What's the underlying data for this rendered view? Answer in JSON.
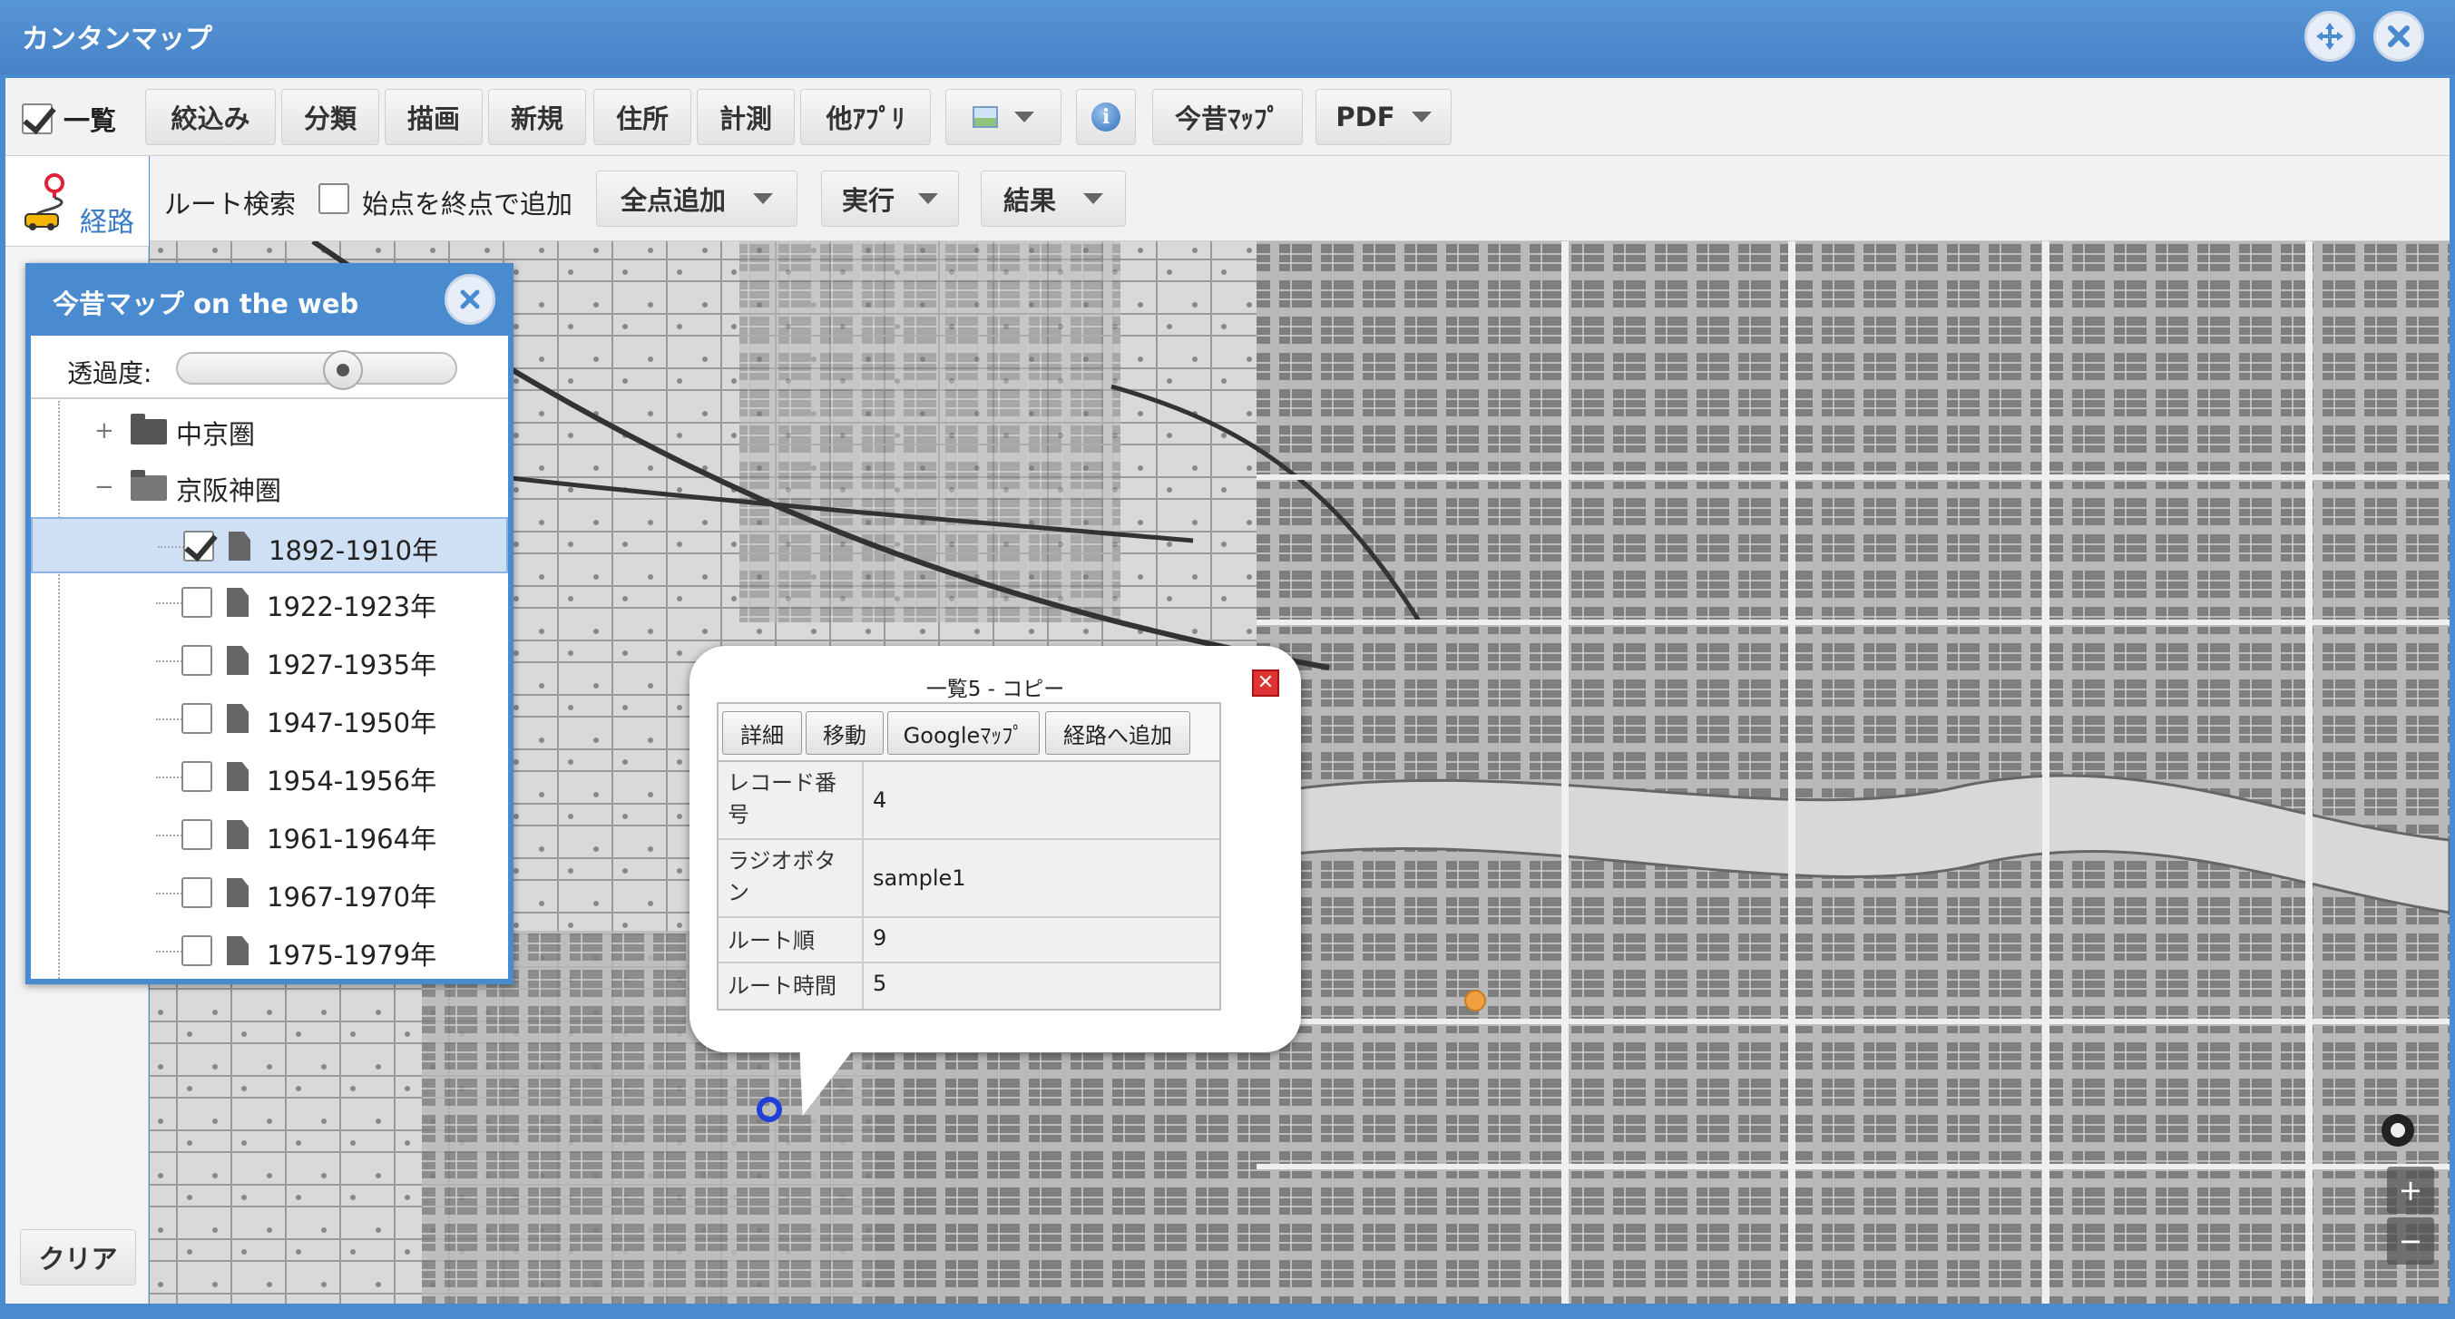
{
  "window": {
    "title": "カンタンマップ"
  },
  "toolbar": {
    "list_label": "一覧",
    "list_checked": true,
    "buttons": [
      "絞込み",
      "分類",
      "描画",
      "新規",
      "住所",
      "計測",
      "他ｱﾌﾟﾘ"
    ],
    "image_button_icon": "map-image-icon",
    "info_button_icon": "info-icon",
    "konjaku_button": "今昔ﾏｯﾌﾟ",
    "pdf_button": "PDF"
  },
  "side": {
    "route_tab_label": "経路",
    "clear_button": "クリア"
  },
  "route_bar": {
    "label": "ルート検索",
    "checkbox_label": "始点を終点で追加",
    "add_all_button": "全点追加",
    "run_button": "実行",
    "result_button": "結果"
  },
  "layer_panel": {
    "title": "今昔マップ on the web",
    "opacity_label": "透過度:",
    "opacity_value": 0.6,
    "folders": [
      {
        "label": "中京圏",
        "expanded": false
      },
      {
        "label": "京阪神圏",
        "expanded": true
      }
    ],
    "layers": [
      {
        "label": "1892-1910年",
        "checked": true,
        "selected": true
      },
      {
        "label": "1922-1923年",
        "checked": false
      },
      {
        "label": "1927-1935年",
        "checked": false
      },
      {
        "label": "1947-1950年",
        "checked": false
      },
      {
        "label": "1954-1956年",
        "checked": false
      },
      {
        "label": "1961-1964年",
        "checked": false
      },
      {
        "label": "1967-1970年",
        "checked": false
      },
      {
        "label": "1975-1979年",
        "checked": false
      }
    ]
  },
  "popup": {
    "title": "一覧5 - コピー",
    "buttons": [
      "詳細",
      "移動",
      "Googleﾏｯﾌﾟ",
      "経路へ追加"
    ],
    "rows": [
      {
        "key": "レコード番号",
        "value": "4"
      },
      {
        "key": "ラジオボタン",
        "value": "sample1"
      },
      {
        "key": "ルート順",
        "value": "9"
      },
      {
        "key": "ルート時間",
        "value": "5"
      }
    ]
  },
  "map_controls": {
    "zoom_in": "+",
    "zoom_out": "−"
  },
  "colors": {
    "accent": "#4a8bd0",
    "marker_blue": "#1e3fd8",
    "marker_orange": "#f0a040"
  }
}
